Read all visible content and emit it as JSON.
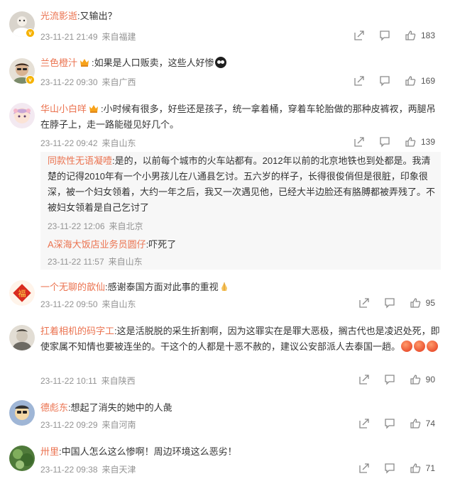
{
  "comments": [
    {
      "name": "光流影逝",
      "text": ":又输出？",
      "time": "23-11-21 21:49",
      "source": "来自福建",
      "likes": "183"
    },
    {
      "name": "兰色橙汁",
      "text": ":如果是人口贩卖，这些人好惨",
      "time": "23-11-22 09:30",
      "source": "来自广西",
      "likes": "169"
    },
    {
      "name": "华山小白咩",
      "text": ":小时候有很多，好些还是孩子，统一拿着桶，穿着车轮胎做的那种皮裤衩，两腿吊在脖子上，走一路能碰见好几个。",
      "time": "23-11-22 09:42",
      "source": "来自山东",
      "likes": "139",
      "replies": [
        {
          "name": "同款性无语凝噎",
          "text": ":是的，以前每个城市的火车站都有。2012年以前的北京地铁也到处都是。我清楚的记得2010年有一个小男孩儿在八通县乞讨。五六岁的样子，长得很俊俏但是很脏，印象很深，被一个妇女领着，大约一年之后，我又一次遇见他，已经大半边脸还有胳膊都被弄残了。不被妇女领着是自己乞讨了",
          "time": "23-11-22 12:06",
          "source": "来自北京"
        },
        {
          "name": "A深海大饭店业务员圆仔",
          "text": ":吓死了",
          "time": "23-11-22 11:57",
          "source": "来自山东"
        }
      ]
    },
    {
      "name": "一个无聊的歆仙",
      "text": ":感谢泰国方面对此事的重视",
      "time": "23-11-22 09:50",
      "source": "来自山东",
      "likes": "95"
    },
    {
      "name": "扛着相机的码字工",
      "text": ":这是活脱脱的采生折割啊，因为这罪实在是罪大恶极，搁古代也是凌迟处死，即使家属不知情也要被连坐的。干这个的人都是十恶不赦的，建议公安部派人去泰国一趟。",
      "time": "23-11-22 10:11",
      "source": "来自陕西",
      "likes": "90"
    },
    {
      "name": "德彪东",
      "text": ":想起了消失的她中的人彘",
      "time": "23-11-22 09:29",
      "source": "来自河南",
      "likes": "74"
    },
    {
      "name": "卅里",
      "text": ":中国人怎么这么惨啊！周边环境这么恶劣！",
      "time": "23-11-22 09:38",
      "source": "来自天津",
      "likes": "71"
    }
  ]
}
